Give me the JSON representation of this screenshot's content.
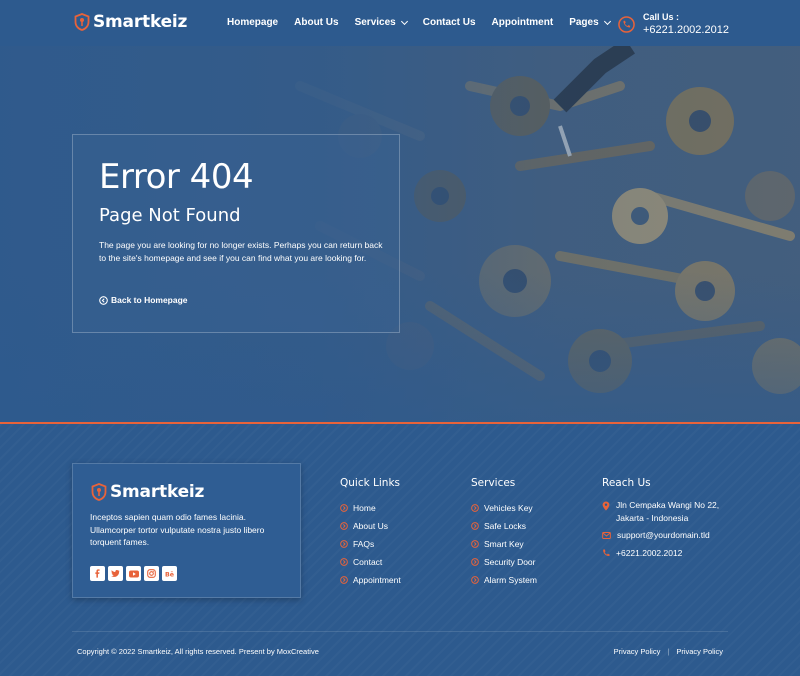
{
  "brand": {
    "name": "Smartkeiz",
    "accent": "#e8633a",
    "primary": "#2d5a8e"
  },
  "nav": {
    "items": [
      {
        "label": "Homepage",
        "dropdown": false
      },
      {
        "label": "About Us",
        "dropdown": false
      },
      {
        "label": "Services",
        "dropdown": true
      },
      {
        "label": "Contact Us",
        "dropdown": false
      },
      {
        "label": "Appointment",
        "dropdown": false
      },
      {
        "label": "Pages",
        "dropdown": true
      }
    ]
  },
  "call": {
    "label": "Call Us :",
    "number": "+6221.2002.2012",
    "icon": "phone-icon"
  },
  "hero": {
    "title": "Error 404",
    "subtitle": "Page Not Found",
    "text": "The page you are looking for no longer exists. Perhaps you can return back to the site's homepage and see if you can find what you are looking for.",
    "back_link": "Back to Homepage"
  },
  "footer": {
    "brand_name": "Smartkeiz",
    "description": "Inceptos sapien quam odio fames lacinia. Ullamcorper tortor vulputate nostra justo libero torquent fames.",
    "socials": [
      "facebook-icon",
      "twitter-icon",
      "youtube-icon",
      "instagram-icon",
      "behance-icon"
    ],
    "quick_links": {
      "title": "Quick Links",
      "items": [
        "Home",
        "About Us",
        "FAQs",
        "Contact",
        "Appointment"
      ]
    },
    "services": {
      "title": "Services",
      "items": [
        "Vehicles Key",
        "Safe Locks",
        "Smart Key",
        "Security Door",
        "Alarm System"
      ]
    },
    "reach": {
      "title": "Reach Us",
      "address": "Jln Cempaka Wangi No 22, Jakarta - Indonesia",
      "email": "support@yourdomain.tld",
      "phone": "+6221.2002.2012"
    },
    "copyright": "Copyright © 2022 Smartkeiz, All rights reserved. Present by MoxCreative",
    "policy_links": [
      "Privacy Policy",
      "Privacy Policy"
    ]
  }
}
